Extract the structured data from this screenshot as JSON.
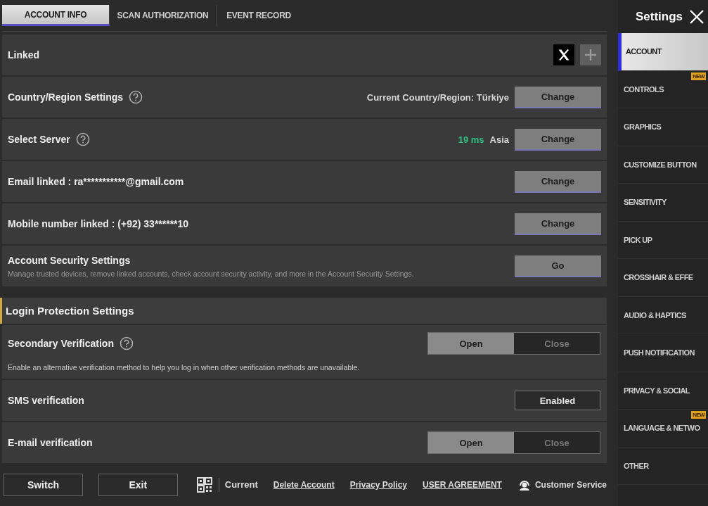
{
  "tabs": [
    {
      "label": "ACCOUNT INFO",
      "selected": true
    },
    {
      "label": "SCAN AUTHORIZATION",
      "selected": false
    },
    {
      "label": "EVENT RECORD",
      "selected": false
    }
  ],
  "rows": [
    {
      "kind": "linked",
      "label": "Linked"
    },
    {
      "kind": "action",
      "label": "Country/Region Settings",
      "help": true,
      "info": "Current Country/Region: Türkiye",
      "button": "Change"
    },
    {
      "kind": "action",
      "label": "Select Server",
      "help": true,
      "ping": "19 ms",
      "info": "Asia",
      "button": "Change"
    },
    {
      "kind": "action",
      "label": "Email linked : ra***********@gmail.com",
      "button": "Change"
    },
    {
      "kind": "action",
      "label": "Mobile number linked : (+92) 33******10",
      "button": "Change"
    },
    {
      "kind": "action",
      "label": "Account Security Settings",
      "description": "Manage trusted devices, remove linked accounts, check account security activity, and more in the Account Security Settings.",
      "button": "Go"
    },
    {
      "kind": "section",
      "label": "Login Protection Settings"
    },
    {
      "kind": "toggle",
      "label": "Secondary Verification",
      "help": true,
      "description": "Enable an alternative verification method to help you log in when other verification methods are unavailable.",
      "options": [
        {
          "label": "Open",
          "selected": true
        },
        {
          "label": "Close",
          "selected": false
        }
      ]
    },
    {
      "kind": "status",
      "label": "SMS verification",
      "status": "Enabled"
    },
    {
      "kind": "toggle",
      "label": "E-mail verification",
      "options": [
        {
          "label": "Open",
          "selected": true
        },
        {
          "label": "Close",
          "selected": false
        }
      ]
    }
  ],
  "footer": {
    "buttons": [
      "Switch",
      "Exit"
    ],
    "qr_label": "Current",
    "links": [
      "Delete Account",
      "Privacy Policy",
      "USER AGREEMENT"
    ],
    "customer_service": "Customer Service"
  },
  "sidebar": {
    "title": "Settings",
    "items": [
      {
        "label": "ACCOUNT",
        "selected": true
      },
      {
        "label": "CONTROLS",
        "selected": false,
        "badge": "NEW"
      },
      {
        "label": "GRAPHICS",
        "selected": false
      },
      {
        "label": "CUSTOMIZE BUTTON",
        "selected": false
      },
      {
        "label": "SENSITIVITY",
        "selected": false
      },
      {
        "label": "PICK UP",
        "selected": false
      },
      {
        "label": "CROSSHAIR & EFFE",
        "selected": false
      },
      {
        "label": "AUDIO & HAPTICS",
        "selected": false
      },
      {
        "label": "PUSH NOTIFICATION",
        "selected": false
      },
      {
        "label": "PRIVACY & SOCIAL",
        "selected": false
      },
      {
        "label": "LANGUAGE & NETWO",
        "selected": false,
        "badge": "NEW"
      },
      {
        "label": "OTHER",
        "selected": false
      }
    ]
  }
}
